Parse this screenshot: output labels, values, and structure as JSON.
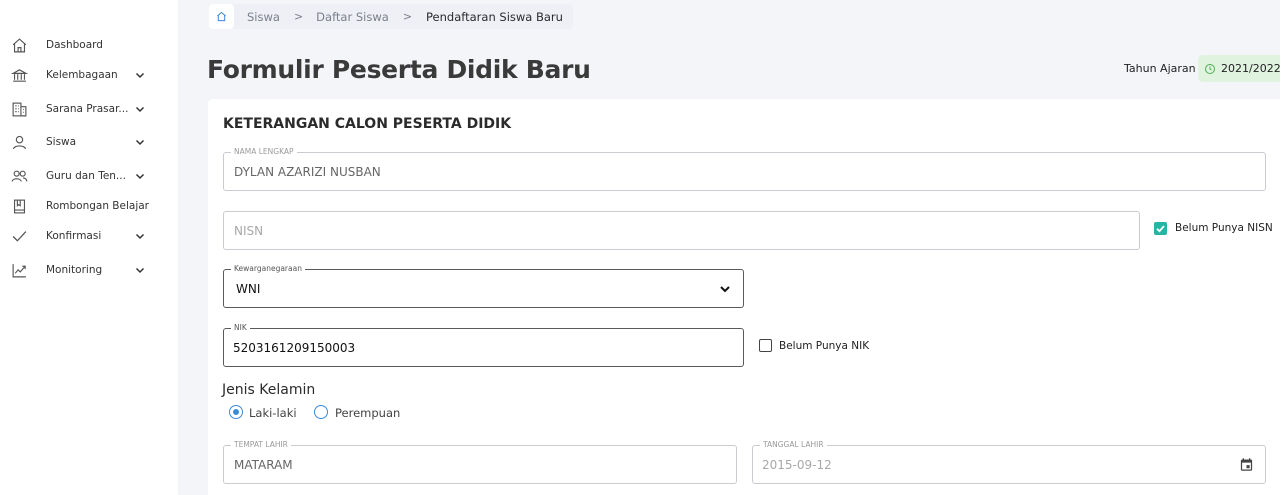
{
  "sidebar": {
    "items": [
      {
        "label": "Dashboard",
        "icon": "home-icon",
        "has_chevron": false
      },
      {
        "label": "Kelembagaan",
        "icon": "institution-icon",
        "has_chevron": true
      },
      {
        "label": "Sarana Prasar...",
        "icon": "building-icon",
        "has_chevron": true
      },
      {
        "label": "Siswa",
        "icon": "user-icon",
        "has_chevron": true
      },
      {
        "label": "Guru dan Ten...",
        "icon": "users-icon",
        "has_chevron": true
      },
      {
        "label": "Rombongan Belajar",
        "icon": "book-icon",
        "has_chevron": false
      },
      {
        "label": "Konfirmasi",
        "icon": "check-icon",
        "has_chevron": true
      },
      {
        "label": "Monitoring",
        "icon": "chart-line-icon",
        "has_chevron": true
      }
    ]
  },
  "breadcrumb": {
    "items": [
      "Siswa",
      "Daftar Siswa"
    ],
    "current": "Pendaftaran Siswa Baru",
    "separator": ">"
  },
  "header": {
    "title": "Formulir Peserta Didik Baru",
    "tahun_ajaran_label": "Tahun Ajaran",
    "tahun_ajaran_value": "2021/2022"
  },
  "form": {
    "section_title": "KETERANGAN CALON PESERTA DIDIK",
    "nama_lengkap": {
      "label": "NAMA LENGKAP",
      "value": "DYLAN AZARIZI NUSBAN"
    },
    "nisn": {
      "placeholder": "NISN",
      "value": ""
    },
    "belum_nisn": {
      "label": "Belum Punya NISN",
      "checked": true
    },
    "kewarganegaraan": {
      "label": "Kewarganegaraan",
      "value": "WNI"
    },
    "nik": {
      "label": "NIK",
      "value": "5203161209150003"
    },
    "belum_nik": {
      "label": "Belum Punya NIK",
      "checked": false
    },
    "jenis_kelamin": {
      "title": "Jenis Kelamin",
      "options": [
        "Laki-laki",
        "Perempuan"
      ],
      "selected": "Laki-laki"
    },
    "tempat_lahir": {
      "label": "TEMPAT LAHIR",
      "value": "MATARAM"
    },
    "tanggal_lahir": {
      "label": "TANGGAL LAHIR",
      "value": "2015-09-12"
    }
  },
  "colors": {
    "accent_blue": "#3a8bd6",
    "checkbox_teal": "#26b5a4",
    "badge_green_bg": "#dff3df",
    "clock_green": "#4caf50"
  }
}
